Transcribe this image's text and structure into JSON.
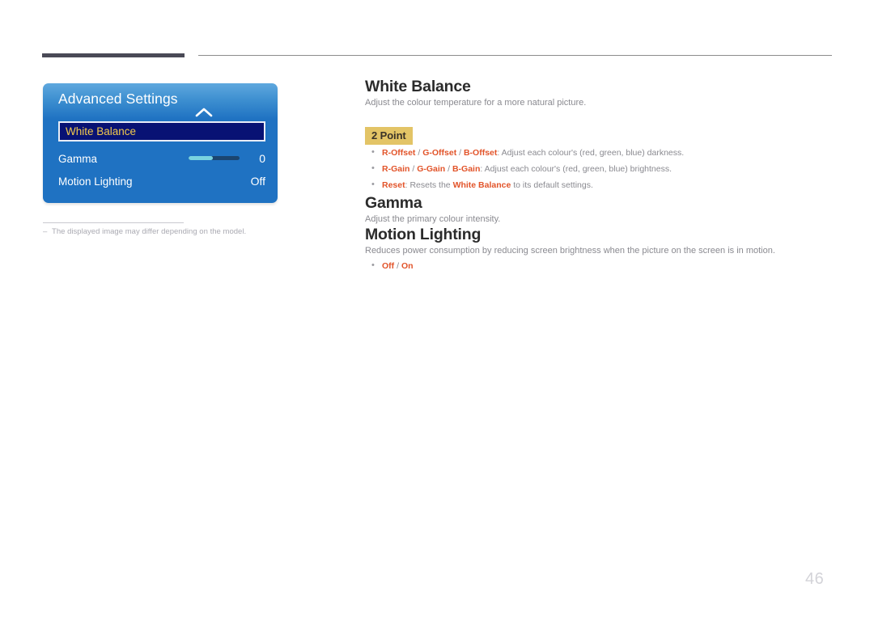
{
  "page": {
    "number": "46"
  },
  "osd": {
    "title": "Advanced Settings",
    "chevron_icon": "chevron-up-icon",
    "rows": [
      {
        "label": "White Balance",
        "value": "",
        "selected": true
      },
      {
        "label": "Gamma",
        "value": "0",
        "selected": false,
        "slider": {
          "fill_percent": 48
        }
      },
      {
        "label": "Motion Lighting",
        "value": "Off",
        "selected": false
      }
    ],
    "colors": {
      "panel_top": "#5fa8de",
      "panel_body": "#1f72c2",
      "selected_bg": "#081274",
      "selected_border": "#e8edf7",
      "selected_text": "#f2c94c",
      "slider_fill": "#79d3e0",
      "slider_track": "#1b4570"
    }
  },
  "footnote": {
    "dash": "–",
    "text": "The displayed image may differ depending on the model."
  },
  "sections": {
    "white_balance": {
      "heading": "White Balance",
      "body": "Adjust the colour temperature for a more natural picture.",
      "chip": "2 Point",
      "chip_color": "#e3c466",
      "bullets": [
        {
          "terms": [
            "R-Offset",
            "G-Offset",
            "B-Offset"
          ],
          "separator": " / ",
          "text": ": Adjust each colour's (red, green, blue) darkness."
        },
        {
          "terms": [
            "R-Gain",
            "G-Gain",
            "B-Gain"
          ],
          "separator": " / ",
          "text": ": Adjust each colour's (red, green, blue) brightness."
        },
        {
          "terms": [
            "Reset"
          ],
          "separator": "",
          "text": ": Resets the White Balance to its default settings.",
          "inline_term": "White Balance"
        }
      ]
    },
    "gamma": {
      "heading": "Gamma",
      "body": "Adjust the primary colour intensity."
    },
    "motion_lighting": {
      "heading": "Motion Lighting",
      "body": "Reduces power consumption by reducing screen brightness when the picture on the screen is in motion.",
      "options": [
        "Off",
        "On"
      ],
      "option_separator": " / "
    }
  },
  "term_color": "#e2542a",
  "heading_color": "#2b2b2b",
  "body_color": "#8a8a90"
}
